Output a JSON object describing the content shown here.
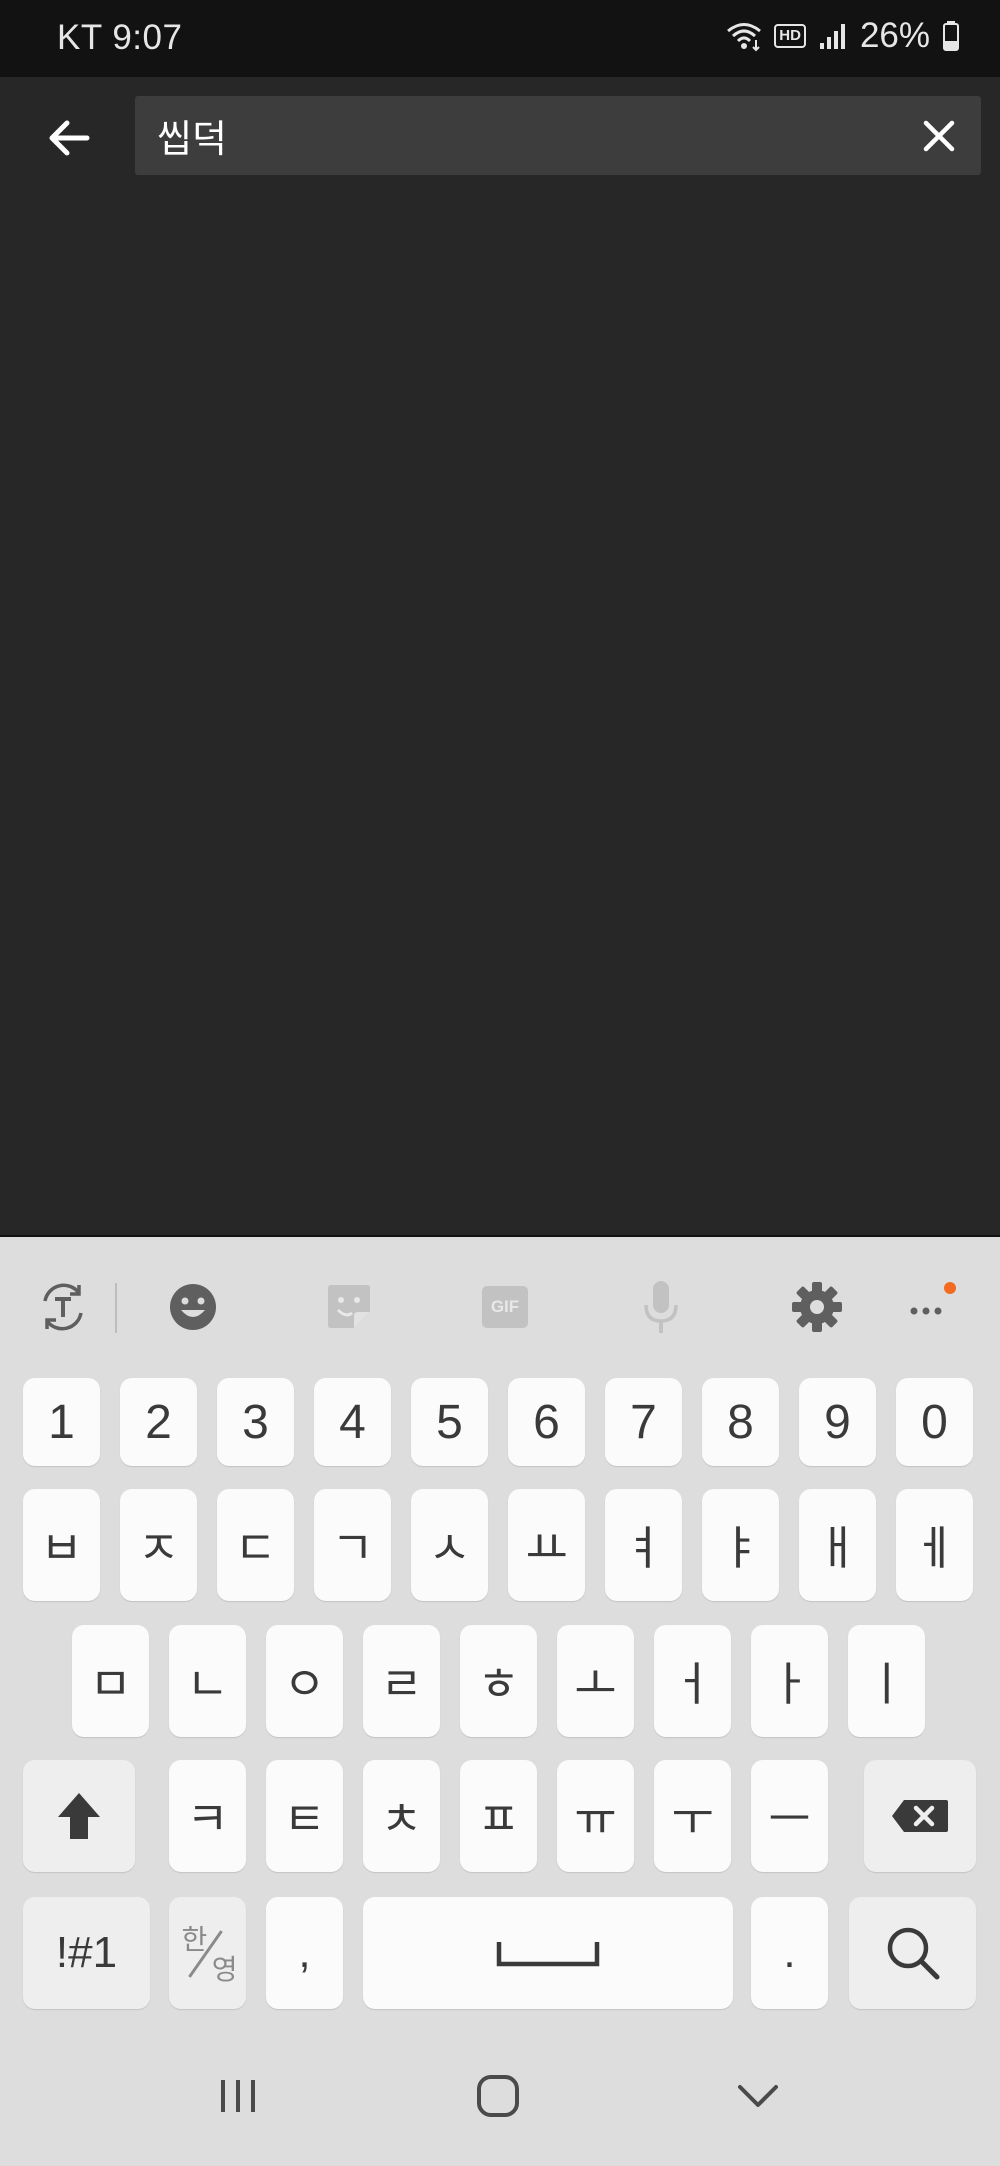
{
  "status_bar": {
    "carrier_time": "KT 9:07",
    "hd_label": "HD",
    "battery": "26%"
  },
  "search": {
    "query": "씹덕",
    "back_icon": "arrow-left-icon",
    "clear_icon": "close-icon"
  },
  "keyboard": {
    "toolbar": {
      "translate_icon": "translate-icon",
      "emoji_icon": "emoji-icon",
      "sticker_icon": "sticker-icon",
      "gif_label": "GIF",
      "mic_icon": "microphone-icon",
      "settings_icon": "gear-icon",
      "more_icon": "more-dots-icon",
      "notification_color": "#f26b21"
    },
    "number_row": [
      "1",
      "2",
      "3",
      "4",
      "5",
      "6",
      "7",
      "8",
      "9",
      "0"
    ],
    "row1": [
      "ㅂ",
      "ㅈ",
      "ㄷ",
      "ㄱ",
      "ㅅ",
      "ㅛ",
      "ㅕ",
      "ㅑ",
      "ㅐ",
      "ㅔ"
    ],
    "row2": [
      "ㅁ",
      "ㄴ",
      "ㅇ",
      "ㄹ",
      "ㅎ",
      "ㅗ",
      "ㅓ",
      "ㅏ",
      "ㅣ"
    ],
    "row3": [
      "ㅋ",
      "ㅌ",
      "ㅊ",
      "ㅍ",
      "ㅠ",
      "ㅜ",
      "ㅡ"
    ],
    "bottom": {
      "symbols_label": "!#1",
      "lang_han": "한",
      "lang_yeong": "영",
      "comma": ",",
      "period": "."
    },
    "key_bg": "#fbfbfb",
    "func_key_bg": "#eeeeee",
    "keyboard_bg": "#dddddd"
  },
  "nav_bar": {
    "recents_icon": "recents-icon",
    "home_icon": "home-icon",
    "hide_keyboard_icon": "chevron-down-icon"
  }
}
